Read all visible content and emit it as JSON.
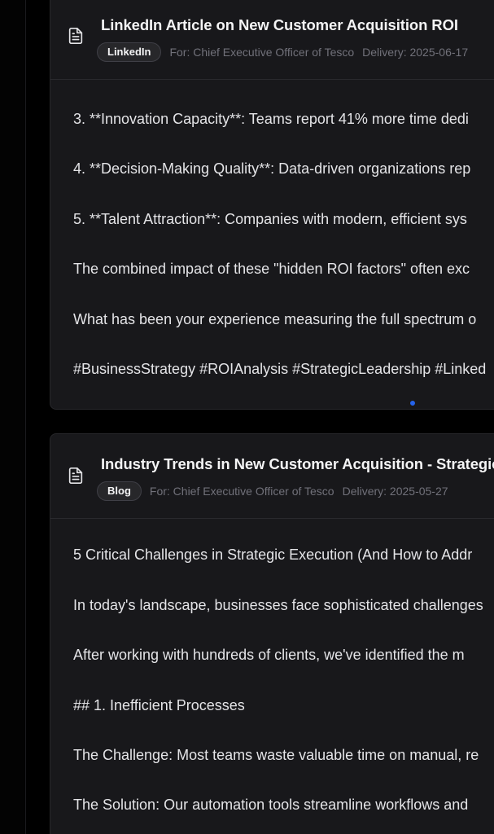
{
  "cards": [
    {
      "title": "LinkedIn Article on New Customer Acquisition ROI",
      "badge": "LinkedIn",
      "for_text": "For: Chief Executive Officer of Tesco",
      "delivery_text": "Delivery: 2025-06-17",
      "icon": "document-icon",
      "paragraphs": [
        "3. **Innovation Capacity**: Teams report 41% more time dedi",
        "4. **Decision-Making Quality**: Data-driven organizations rep",
        "5. **Talent Attraction**: Companies with modern, efficient sys",
        "The combined impact of these \"hidden ROI factors\" often exc",
        "What has been your experience measuring the full spectrum o",
        "#BusinessStrategy #ROIAnalysis #StrategicLeadership #Linked"
      ]
    },
    {
      "title": "Industry Trends in New Customer Acquisition - Strategic",
      "badge": "Blog",
      "for_text": "For: Chief Executive Officer of Tesco",
      "delivery_text": "Delivery: 2025-05-27",
      "icon": "document-icon",
      "paragraphs": [
        "5 Critical Challenges in Strategic Execution (And How to Addr",
        "In today's landscape, businesses face sophisticated challenges",
        "After working with hundreds of clients, we've identified the m",
        "## 1. Inefficient Processes",
        "The Challenge: Most teams waste valuable time on manual, re",
        "The Solution: Our automation tools streamline workflows and"
      ]
    }
  ],
  "colors": {
    "background": "#000000",
    "card_background": "#18181b",
    "card_border": "#27272a",
    "text_primary": "#f4f4f5",
    "text_body": "#e4e4e7",
    "text_muted": "#71717a",
    "accent_dot": "#2563eb"
  }
}
